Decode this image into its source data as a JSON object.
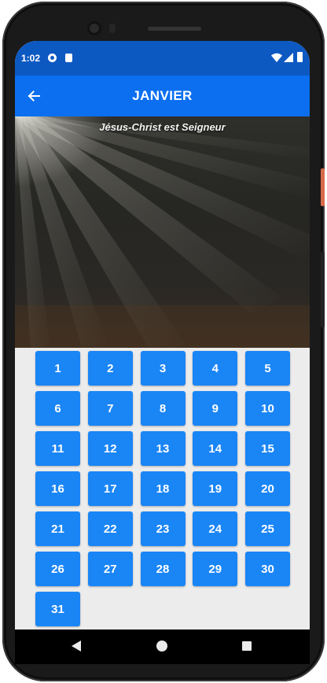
{
  "status": {
    "time": "1:02",
    "icons": [
      "notification-icon",
      "sim-card-icon",
      "wifi-icon",
      "signal-icon",
      "battery-icon"
    ]
  },
  "appbar": {
    "title": "JANVIER",
    "back_icon": "arrow-left-icon"
  },
  "hero": {
    "caption": "Jésus-Christ est Seigneur"
  },
  "days": [
    "1",
    "2",
    "3",
    "4",
    "5",
    "6",
    "7",
    "8",
    "9",
    "10",
    "11",
    "12",
    "13",
    "14",
    "15",
    "16",
    "17",
    "18",
    "19",
    "20",
    "21",
    "22",
    "23",
    "24",
    "25",
    "26",
    "27",
    "28",
    "29",
    "30",
    "31"
  ],
  "colors": {
    "status_bar": "#0d59c2",
    "app_bar": "#0b6ff0",
    "day_button": "#1a85f5",
    "background": "#ececec"
  },
  "navbar": {
    "icons": [
      "nav-back-icon",
      "nav-home-icon",
      "nav-recents-icon"
    ]
  }
}
